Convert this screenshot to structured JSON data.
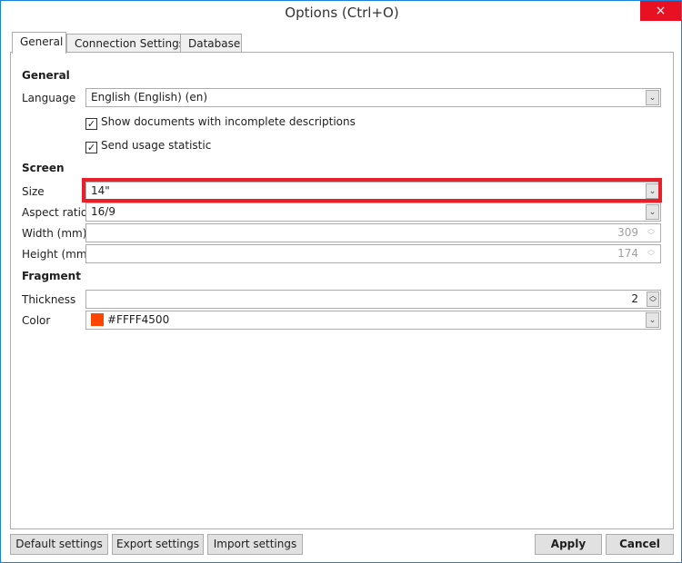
{
  "window": {
    "title": "Options (Ctrl+O)",
    "close_icon": "×"
  },
  "tabs": [
    {
      "label": "General"
    },
    {
      "label": "Connection Settings"
    },
    {
      "label": "Database"
    }
  ],
  "general": {
    "header": "General",
    "language_label": "Language",
    "language_value": "English (English) (en)",
    "show_docs_label": "Show documents with incomplete descriptions",
    "show_docs_checked": true,
    "usage_label": "Send usage statistic",
    "usage_checked": true
  },
  "screen": {
    "header": "Screen",
    "size_label": "Size",
    "size_value": "14\"",
    "aspect_label": "Aspect ratio",
    "aspect_value": "16/9",
    "width_label": "Width (mm)",
    "width_value": "309",
    "height_label": "Height (mm)",
    "height_value": "174"
  },
  "fragment": {
    "header": "Fragment",
    "thickness_label": "Thickness",
    "thickness_value": "2",
    "color_label": "Color",
    "color_value": "#FFFF4500",
    "color_swatch": "#ff4500"
  },
  "buttons": {
    "default": "Default settings",
    "export": "Export settings",
    "import": "Import settings",
    "apply": "Apply",
    "cancel": "Cancel"
  },
  "highlight_color": "#e8202a"
}
